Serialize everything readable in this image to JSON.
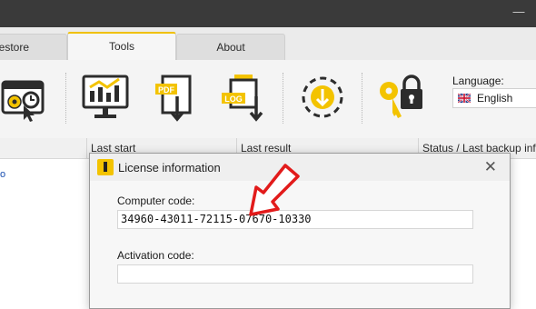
{
  "window": {
    "minimize_glyph": "—"
  },
  "tabs": [
    {
      "label": "Restore"
    },
    {
      "label": "Tools"
    },
    {
      "label": "About"
    }
  ],
  "toolbar": {
    "pdf_text": "PDF",
    "log_text": "LOG",
    "language_label": "Language:",
    "language_value": "English"
  },
  "table": {
    "headers": [
      "Last start",
      "Last result",
      "Status / Last backup info"
    ],
    "row_stub": "o"
  },
  "dialog": {
    "title": "License information",
    "close_glyph": "✕",
    "computer_code_label": "Computer code:",
    "computer_code_value": "34960-43011-72115-07670-10330",
    "activation_code_label": "Activation code:",
    "activation_code_value": ""
  },
  "colors": {
    "accent": "#f3c300",
    "arrow": "#e21b1b",
    "titlebar": "#3a3a3a"
  }
}
